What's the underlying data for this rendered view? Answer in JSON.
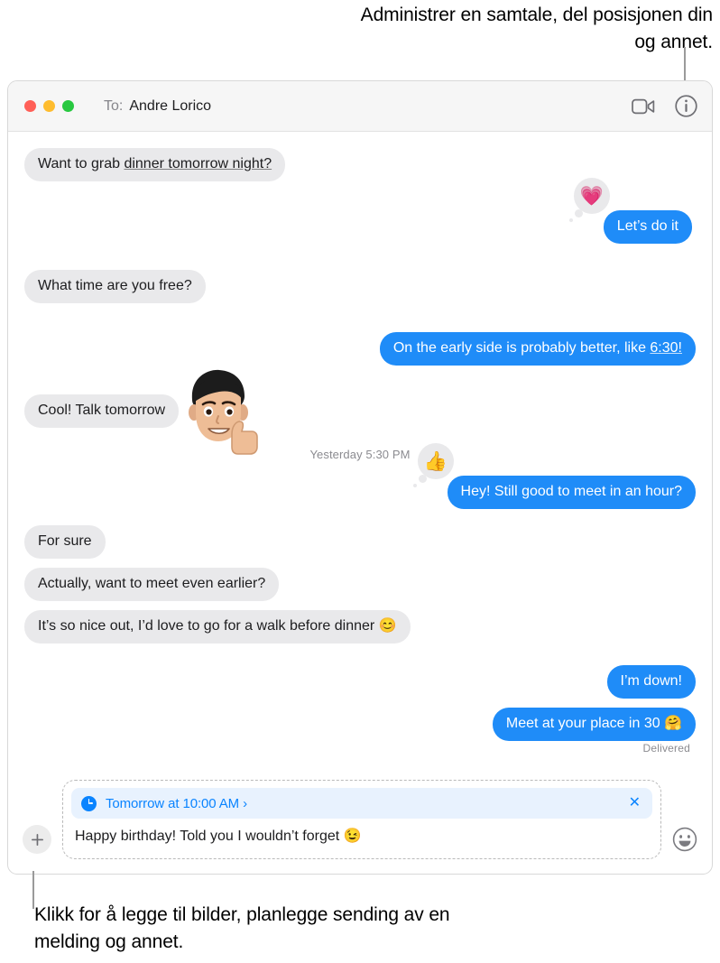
{
  "callouts": {
    "top": "Administrer en samtale, del posisjonen din og annet.",
    "bottom": "Klikk for å legge til bilder, planlegge sending av en melding og annet."
  },
  "window": {
    "titlebar": {
      "to_label": "To:",
      "recipient": "Andre Lorico",
      "traffic_lights": {
        "close_color": "#ff5f57",
        "minimize_color": "#febc2e",
        "zoom_color": "#28c840"
      },
      "actions": [
        {
          "name": "facetime-video-icon",
          "label": "FaceTime video"
        },
        {
          "name": "info-icon",
          "label": "Details"
        }
      ]
    },
    "thread": {
      "messages": [
        {
          "id": "m1",
          "side": "left",
          "text_before": "Want to grab ",
          "link": "dinner tomorrow night?",
          "text_after": "",
          "tapback": null
        },
        {
          "id": "m2",
          "side": "right",
          "text_before": "Let’s do it",
          "link": "",
          "text_after": "",
          "tapback": "💗"
        },
        {
          "id": "m3",
          "side": "left",
          "text_before": "What time are you free?",
          "link": "",
          "text_after": "",
          "tapback": null
        },
        {
          "id": "m4",
          "side": "right",
          "text_before": "On the early side is probably better, like ",
          "link": "6:30!",
          "text_after": "",
          "tapback": null
        },
        {
          "id": "m5",
          "side": "left",
          "text_before": "Cool! Talk tomorrow",
          "link": "",
          "text_after": "",
          "sticker": "🧑"
        },
        {
          "id": "m6",
          "side": "right",
          "text_before": "Hey! Still good to meet in an hour?",
          "link": "",
          "text_after": "",
          "tapback": "👍"
        },
        {
          "id": "m7",
          "side": "left",
          "text_before": "For sure",
          "link": "",
          "text_after": "",
          "tapback": null
        },
        {
          "id": "m8",
          "side": "left",
          "text_before": "Actually, want to meet even earlier?",
          "link": "",
          "text_after": "",
          "tapback": null
        },
        {
          "id": "m9",
          "side": "left",
          "text_before": "It’s so nice out, I’d love to go for a walk before dinner 😊",
          "link": "",
          "text_after": "",
          "tapback": null
        },
        {
          "id": "m10",
          "side": "right",
          "text_before": "I’m down!",
          "link": "",
          "text_after": "",
          "tapback": null
        },
        {
          "id": "m11",
          "side": "right",
          "text_before": "Meet at your place in 30 🤗",
          "link": "",
          "text_after": "",
          "tapback": null
        }
      ],
      "timestamp": "Yesterday 5:30 PM",
      "delivered_status": "Delivered"
    },
    "compose": {
      "add_button_label": "+",
      "scheduled": {
        "icon": "clock-icon",
        "text": "Tomorrow at 10:00 AM ›",
        "close_label": "✕"
      },
      "message_text": "Happy birthday! Told you I wouldn’t forget 😉",
      "emoji_button_label": "Emoji picker"
    }
  },
  "colors": {
    "bubble_outgoing": "#1f8cf8",
    "bubble_incoming": "#e9e9eb",
    "accent_blue": "#0a84ff",
    "banner_bg": "#e8f2fe",
    "titlebar_bg": "#f6f6f6"
  }
}
